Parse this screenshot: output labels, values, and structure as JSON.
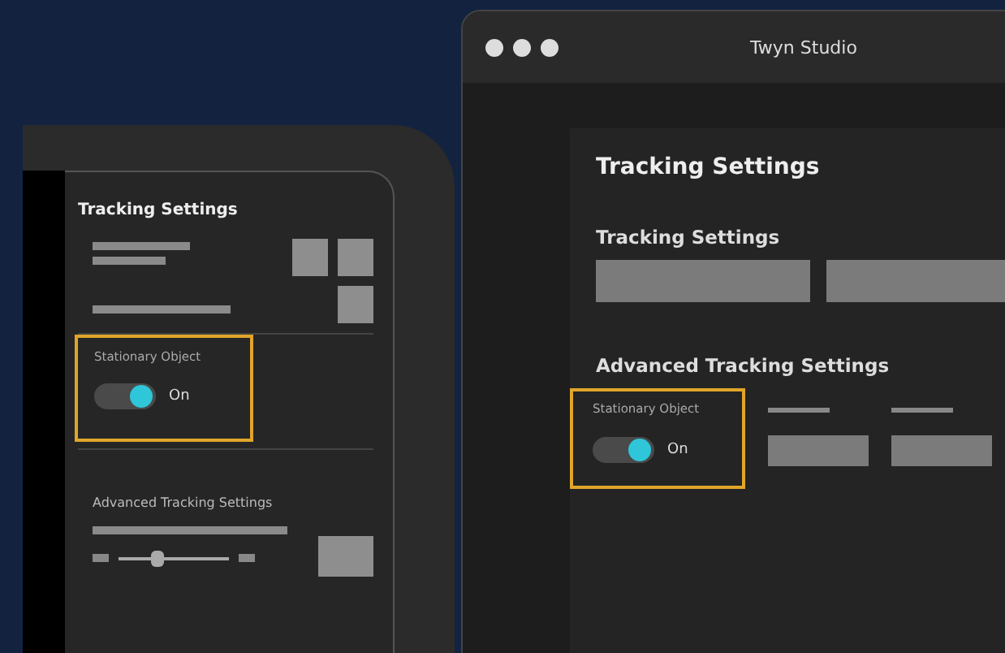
{
  "side_panel": {
    "title": "Tracking Settings",
    "stationary_toggle": {
      "label": "Stationary Object",
      "on": true,
      "state_text": "On"
    },
    "advanced_title": "Advanced Tracking Settings",
    "slider": {
      "level": 0.35
    }
  },
  "window": {
    "title": "Twyn Studio",
    "heading": "Tracking Settings",
    "section_title": "Tracking Settings",
    "advanced_title": "Advanced Tracking Settings",
    "stationary_toggle": {
      "label": "Stationary Object",
      "on": true,
      "state_text": "On"
    }
  }
}
